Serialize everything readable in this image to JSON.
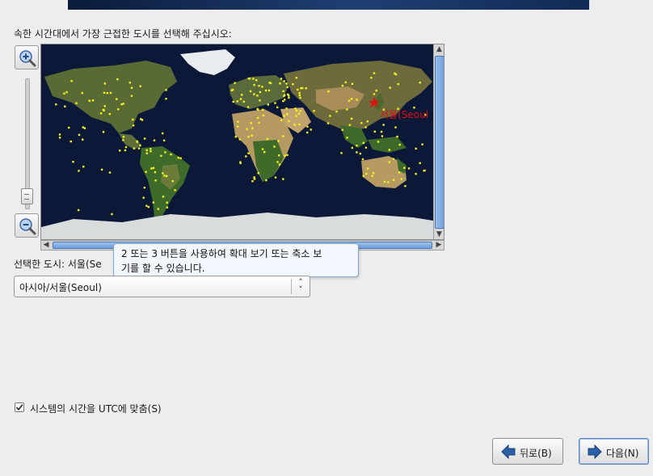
{
  "prompt": "속한 시간대에서 가장 근접한 도시를 선택해 주십시오:",
  "map": {
    "highlighted_city_label": "서울(Seoul"
  },
  "tooltip": {
    "line1": "2 또는 3 버튼을 사용하여 확대 보기 또는 축소 보",
    "line2": "기를 할 수 있습니다."
  },
  "selected_city_label": "선택한 도시: 서울(Se",
  "timezone_select": {
    "value": "아시아/서울(Seoul)"
  },
  "utc_checkbox": {
    "label": "시스템의 시간을 UTC에 맞춤(S)",
    "checked": true
  },
  "buttons": {
    "back": "뒤로(B)",
    "next": "다음(N)"
  },
  "icons": {
    "zoom_in": "zoom-in-icon",
    "zoom_out": "zoom-out-icon",
    "back": "left-arrow-icon",
    "next": "right-arrow-icon",
    "city_marker": "red-star-icon"
  },
  "colors": {
    "ocean": "#0b1838",
    "city_dot": "#f2f21a",
    "selected_city": "#e01010",
    "accent": "#4b79b6"
  }
}
